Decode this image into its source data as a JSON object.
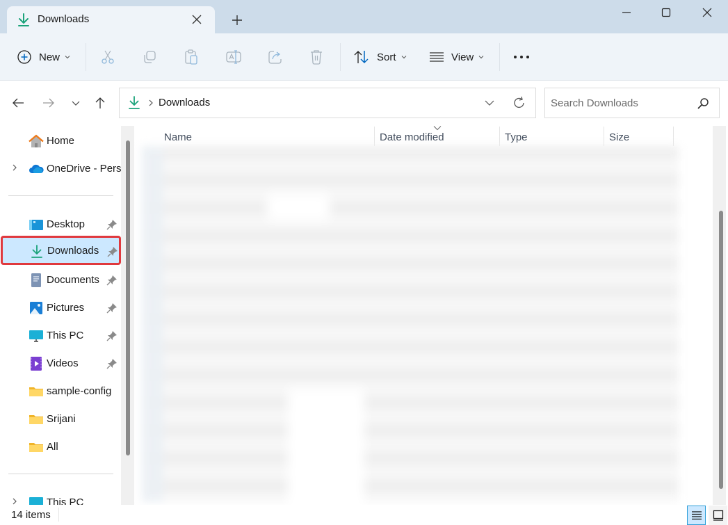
{
  "window": {
    "tab_title": "Downloads",
    "controls": {
      "minimize": "minimize",
      "maximize": "maximize",
      "close": "close"
    }
  },
  "commandbar": {
    "new_label": "New",
    "sort_label": "Sort",
    "view_label": "View",
    "actions": [
      "cut",
      "copy",
      "paste",
      "rename",
      "share",
      "delete"
    ]
  },
  "address": {
    "breadcrumb": [
      "Downloads"
    ],
    "search_placeholder": "Search Downloads",
    "search_value": ""
  },
  "sidebar": {
    "items": [
      {
        "label": "Home",
        "icon": "home-icon",
        "pinned": false,
        "expandable": false
      },
      {
        "label": "OneDrive - Personal",
        "icon": "onedrive-cloud-icon",
        "pinned": false,
        "expandable": true
      },
      {
        "label": "Desktop",
        "icon": "desktop-icon",
        "pinned": true,
        "expandable": false
      },
      {
        "label": "Downloads",
        "icon": "download-icon",
        "pinned": true,
        "expandable": false,
        "selected": true
      },
      {
        "label": "Documents",
        "icon": "documents-icon",
        "pinned": true,
        "expandable": false
      },
      {
        "label": "Pictures",
        "icon": "pictures-icon",
        "pinned": true,
        "expandable": false
      },
      {
        "label": "This PC",
        "icon": "monitor-icon",
        "pinned": true,
        "expandable": false
      },
      {
        "label": "Videos",
        "icon": "videos-icon",
        "pinned": true,
        "expandable": false
      },
      {
        "label": "sample-config",
        "icon": "folder-icon",
        "pinned": false,
        "expandable": false
      },
      {
        "label": "Srijani",
        "icon": "folder-icon",
        "pinned": false,
        "expandable": false
      },
      {
        "label": "All",
        "icon": "folder-icon",
        "pinned": false,
        "expandable": false
      },
      {
        "label": "This PC",
        "icon": "this-pc-icon",
        "pinned": false,
        "expandable": true
      }
    ],
    "sidebar_label_truncated": "OneDrive - Perso"
  },
  "filelist": {
    "columns": [
      "Name",
      "Date modified",
      "Type",
      "Size"
    ],
    "sorted_column": "Date modified",
    "sort_direction": "descending",
    "rows_blurred": true
  },
  "status": {
    "item_count": "14 items",
    "active_view": "details"
  },
  "colors": {
    "titlebar": "#cddcea",
    "chrome": "#eff4f9",
    "selected_bg": "#cce8ff",
    "highlight_border": "#e0393e",
    "download_green": "#1ba37a",
    "accent_blue": "#0067c0"
  }
}
